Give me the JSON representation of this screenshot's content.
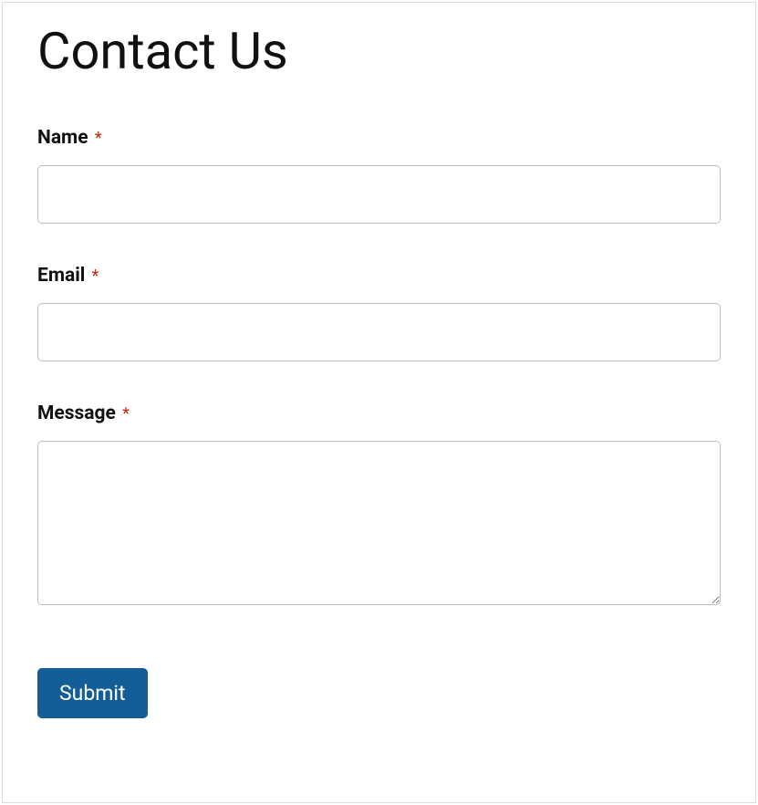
{
  "page": {
    "title": "Contact Us"
  },
  "form": {
    "fields": {
      "name": {
        "label": "Name",
        "required_marker": "*",
        "value": ""
      },
      "email": {
        "label": "Email",
        "required_marker": "*",
        "value": ""
      },
      "message": {
        "label": "Message",
        "required_marker": "*",
        "value": ""
      }
    },
    "submit_label": "Submit"
  }
}
